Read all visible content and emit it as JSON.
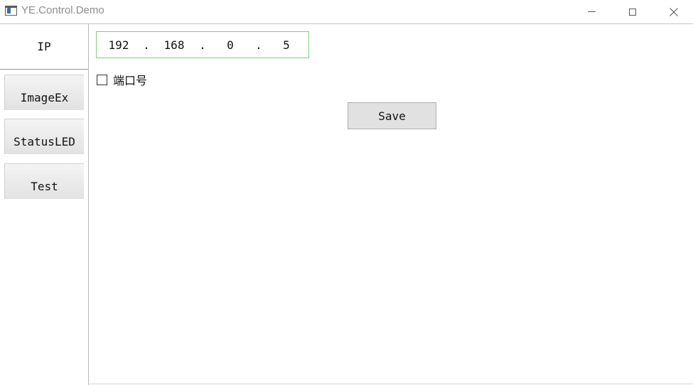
{
  "window": {
    "title": "YE.Control.Demo",
    "controls": {
      "minimize": "minimize-icon",
      "maximize": "maximize-icon",
      "close": "close-icon"
    }
  },
  "sidebar": {
    "items": [
      {
        "label": "IP",
        "selected": true
      },
      {
        "label": "ImageEx",
        "selected": false
      },
      {
        "label": "StatusLED",
        "selected": false
      },
      {
        "label": "Test",
        "selected": false
      }
    ]
  },
  "ip_input": {
    "segments": [
      "192",
      "168",
      "0",
      "5"
    ],
    "separator": ".",
    "border_color": "#7ed07e"
  },
  "port_checkbox": {
    "label": "端口号",
    "checked": false
  },
  "save_button": {
    "label": "Save"
  }
}
